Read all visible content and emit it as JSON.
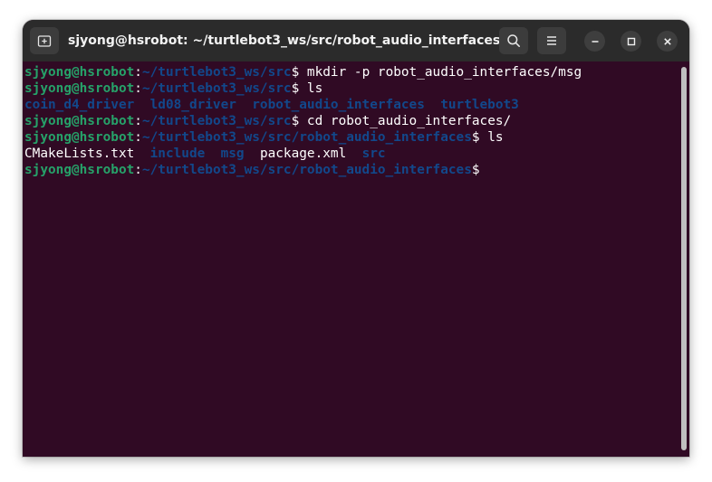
{
  "window": {
    "title": "sjyong@hsrobot: ~/turtlebot3_ws/src/robot_audio_interfaces"
  },
  "icons": {
    "new_tab": "new-tab-icon",
    "search": "search-icon",
    "menu": "hamburger-menu-icon",
    "minimize": "minimize-icon",
    "maximize": "maximize-icon",
    "close": "close-icon"
  },
  "colors": {
    "terminal_bg": "#300a24",
    "titlebar_bg": "#2b2b2b",
    "prompt_user": "#26a269",
    "prompt_path": "#12488b",
    "directory": "#12488b",
    "text": "#ffffff"
  },
  "terminal": {
    "lines": [
      {
        "user": "sjyong@hsrobot",
        "sep": ":",
        "path": "~/turtlebot3_ws/src",
        "symbol": "$",
        "command": " mkdir -p robot_audio_interfaces/msg"
      },
      {
        "user": "sjyong@hsrobot",
        "sep": ":",
        "path": "~/turtlebot3_ws/src",
        "symbol": "$",
        "command": " ls"
      },
      {
        "output": [
          {
            "name": "coin_d4_driver",
            "type": "dir"
          },
          {
            "name": "ld08_driver",
            "type": "dir"
          },
          {
            "name": "robot_audio_interfaces",
            "type": "dir"
          },
          {
            "name": "turtlebot3",
            "type": "dir"
          }
        ]
      },
      {
        "user": "sjyong@hsrobot",
        "sep": ":",
        "path": "~/turtlebot3_ws/src",
        "symbol": "$",
        "command": " cd robot_audio_interfaces/"
      },
      {
        "user": "sjyong@hsrobot",
        "sep": ":",
        "path": "~/turtlebot3_ws/src/robot_audio_interfaces",
        "symbol": "$",
        "command": " ls"
      },
      {
        "output": [
          {
            "name": "CMakeLists.txt",
            "type": "file"
          },
          {
            "name": "include",
            "type": "dir"
          },
          {
            "name": "msg",
            "type": "dir"
          },
          {
            "name": "package.xml",
            "type": "file"
          },
          {
            "name": "src",
            "type": "dir"
          }
        ]
      },
      {
        "user": "sjyong@hsrobot",
        "sep": ":",
        "path": "~/turtlebot3_ws/src/robot_audio_interfaces",
        "symbol": "$",
        "command": ""
      }
    ]
  }
}
